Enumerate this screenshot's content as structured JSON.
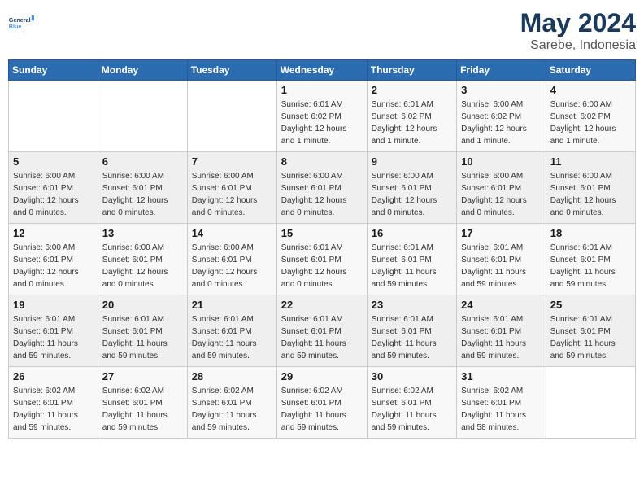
{
  "logo": {
    "line1": "General",
    "line2": "Blue"
  },
  "title": "May 2024",
  "location": "Sarebe, Indonesia",
  "days_header": [
    "Sunday",
    "Monday",
    "Tuesday",
    "Wednesday",
    "Thursday",
    "Friday",
    "Saturday"
  ],
  "weeks": [
    [
      {
        "day": "",
        "info": ""
      },
      {
        "day": "",
        "info": ""
      },
      {
        "day": "",
        "info": ""
      },
      {
        "day": "1",
        "info": "Sunrise: 6:01 AM\nSunset: 6:02 PM\nDaylight: 12 hours\nand 1 minute."
      },
      {
        "day": "2",
        "info": "Sunrise: 6:01 AM\nSunset: 6:02 PM\nDaylight: 12 hours\nand 1 minute."
      },
      {
        "day": "3",
        "info": "Sunrise: 6:00 AM\nSunset: 6:02 PM\nDaylight: 12 hours\nand 1 minute."
      },
      {
        "day": "4",
        "info": "Sunrise: 6:00 AM\nSunset: 6:02 PM\nDaylight: 12 hours\nand 1 minute."
      }
    ],
    [
      {
        "day": "5",
        "info": "Sunrise: 6:00 AM\nSunset: 6:01 PM\nDaylight: 12 hours\nand 0 minutes."
      },
      {
        "day": "6",
        "info": "Sunrise: 6:00 AM\nSunset: 6:01 PM\nDaylight: 12 hours\nand 0 minutes."
      },
      {
        "day": "7",
        "info": "Sunrise: 6:00 AM\nSunset: 6:01 PM\nDaylight: 12 hours\nand 0 minutes."
      },
      {
        "day": "8",
        "info": "Sunrise: 6:00 AM\nSunset: 6:01 PM\nDaylight: 12 hours\nand 0 minutes."
      },
      {
        "day": "9",
        "info": "Sunrise: 6:00 AM\nSunset: 6:01 PM\nDaylight: 12 hours\nand 0 minutes."
      },
      {
        "day": "10",
        "info": "Sunrise: 6:00 AM\nSunset: 6:01 PM\nDaylight: 12 hours\nand 0 minutes."
      },
      {
        "day": "11",
        "info": "Sunrise: 6:00 AM\nSunset: 6:01 PM\nDaylight: 12 hours\nand 0 minutes."
      }
    ],
    [
      {
        "day": "12",
        "info": "Sunrise: 6:00 AM\nSunset: 6:01 PM\nDaylight: 12 hours\nand 0 minutes."
      },
      {
        "day": "13",
        "info": "Sunrise: 6:00 AM\nSunset: 6:01 PM\nDaylight: 12 hours\nand 0 minutes."
      },
      {
        "day": "14",
        "info": "Sunrise: 6:00 AM\nSunset: 6:01 PM\nDaylight: 12 hours\nand 0 minutes."
      },
      {
        "day": "15",
        "info": "Sunrise: 6:01 AM\nSunset: 6:01 PM\nDaylight: 12 hours\nand 0 minutes."
      },
      {
        "day": "16",
        "info": "Sunrise: 6:01 AM\nSunset: 6:01 PM\nDaylight: 11 hours\nand 59 minutes."
      },
      {
        "day": "17",
        "info": "Sunrise: 6:01 AM\nSunset: 6:01 PM\nDaylight: 11 hours\nand 59 minutes."
      },
      {
        "day": "18",
        "info": "Sunrise: 6:01 AM\nSunset: 6:01 PM\nDaylight: 11 hours\nand 59 minutes."
      }
    ],
    [
      {
        "day": "19",
        "info": "Sunrise: 6:01 AM\nSunset: 6:01 PM\nDaylight: 11 hours\nand 59 minutes."
      },
      {
        "day": "20",
        "info": "Sunrise: 6:01 AM\nSunset: 6:01 PM\nDaylight: 11 hours\nand 59 minutes."
      },
      {
        "day": "21",
        "info": "Sunrise: 6:01 AM\nSunset: 6:01 PM\nDaylight: 11 hours\nand 59 minutes."
      },
      {
        "day": "22",
        "info": "Sunrise: 6:01 AM\nSunset: 6:01 PM\nDaylight: 11 hours\nand 59 minutes."
      },
      {
        "day": "23",
        "info": "Sunrise: 6:01 AM\nSunset: 6:01 PM\nDaylight: 11 hours\nand 59 minutes."
      },
      {
        "day": "24",
        "info": "Sunrise: 6:01 AM\nSunset: 6:01 PM\nDaylight: 11 hours\nand 59 minutes."
      },
      {
        "day": "25",
        "info": "Sunrise: 6:01 AM\nSunset: 6:01 PM\nDaylight: 11 hours\nand 59 minutes."
      }
    ],
    [
      {
        "day": "26",
        "info": "Sunrise: 6:02 AM\nSunset: 6:01 PM\nDaylight: 11 hours\nand 59 minutes."
      },
      {
        "day": "27",
        "info": "Sunrise: 6:02 AM\nSunset: 6:01 PM\nDaylight: 11 hours\nand 59 minutes."
      },
      {
        "day": "28",
        "info": "Sunrise: 6:02 AM\nSunset: 6:01 PM\nDaylight: 11 hours\nand 59 minutes."
      },
      {
        "day": "29",
        "info": "Sunrise: 6:02 AM\nSunset: 6:01 PM\nDaylight: 11 hours\nand 59 minutes."
      },
      {
        "day": "30",
        "info": "Sunrise: 6:02 AM\nSunset: 6:01 PM\nDaylight: 11 hours\nand 59 minutes."
      },
      {
        "day": "31",
        "info": "Sunrise: 6:02 AM\nSunset: 6:01 PM\nDaylight: 11 hours\nand 58 minutes."
      },
      {
        "day": "",
        "info": ""
      }
    ]
  ]
}
